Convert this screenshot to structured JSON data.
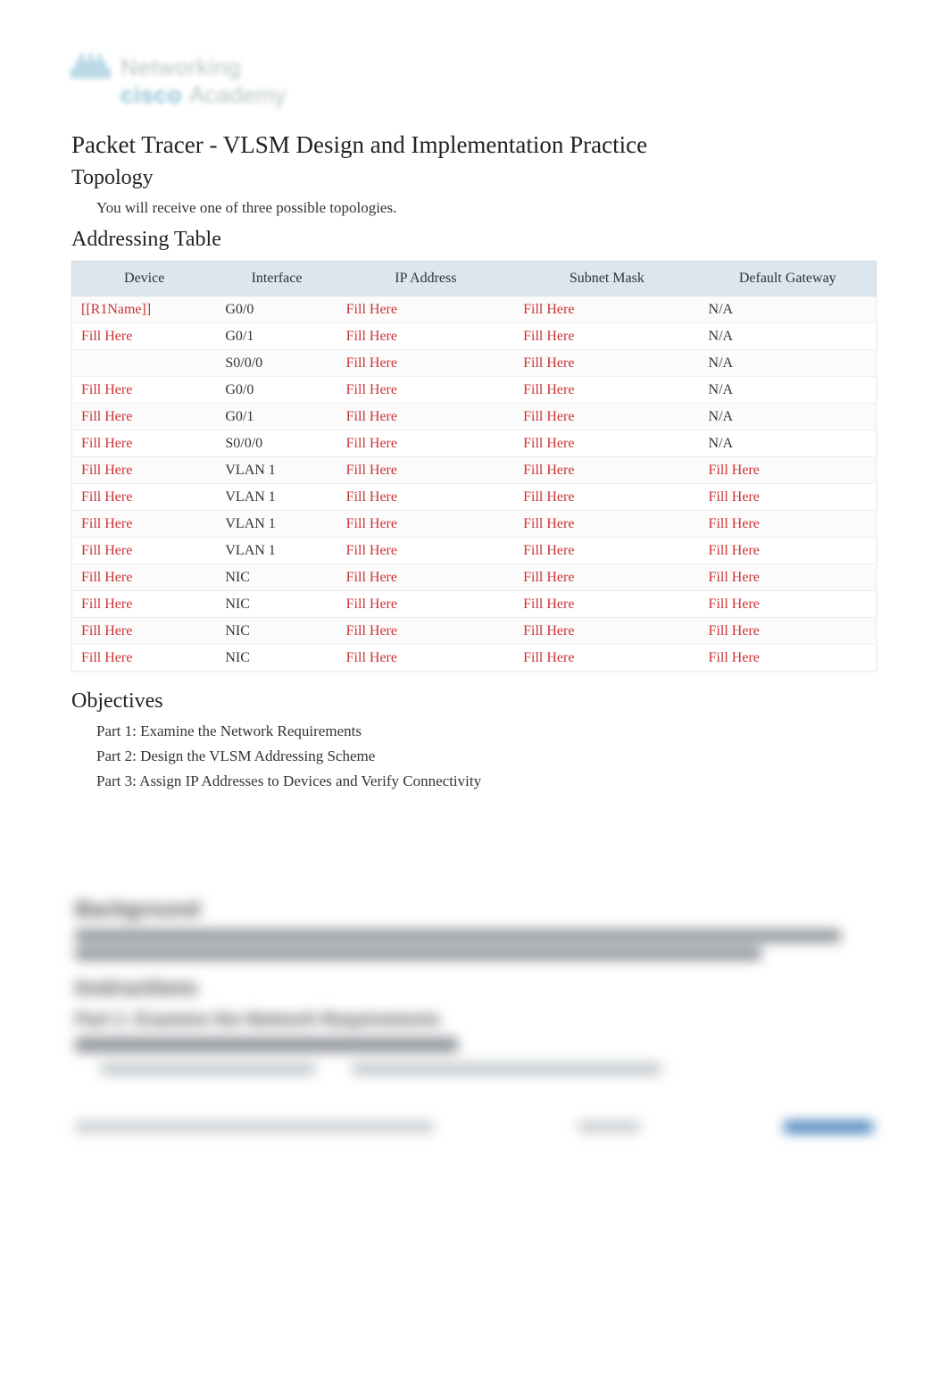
{
  "logo": {
    "top": "Networking",
    "brand": "cisco",
    "sub": "Academy"
  },
  "doc_title": "Packet Tracer - VLSM Design and Implementation Practice",
  "sections": {
    "topology": "Topology",
    "topology_text": "You will receive one of three possible topologies.",
    "addressing_table": "Addressing Table",
    "objectives": "Objectives"
  },
  "table": {
    "headers": {
      "device": "Device",
      "interface": "Interface",
      "ip": "IP Address",
      "mask": "Subnet Mask",
      "gateway": "Default Gateway"
    },
    "rows": [
      {
        "device": "[[R1Name]]",
        "device_fill": true,
        "interface": "G0/0",
        "ip": "Fill Here",
        "mask": "Fill Here",
        "gw": "N/A",
        "gw_fill": false
      },
      {
        "device": "Fill Here",
        "device_fill": true,
        "interface": "G0/1",
        "ip": "Fill Here",
        "mask": "Fill Here",
        "gw": "N/A",
        "gw_fill": false
      },
      {
        "device": "",
        "device_fill": false,
        "interface": "S0/0/0",
        "ip": "Fill Here",
        "mask": "Fill Here",
        "gw": "N/A",
        "gw_fill": false
      },
      {
        "device": "Fill Here",
        "device_fill": true,
        "interface": "G0/0",
        "ip": "Fill Here",
        "mask": "Fill Here",
        "gw": "N/A",
        "gw_fill": false
      },
      {
        "device": "Fill Here",
        "device_fill": true,
        "interface": "G0/1",
        "ip": "Fill Here",
        "mask": "Fill Here",
        "gw": "N/A",
        "gw_fill": false
      },
      {
        "device": "Fill Here",
        "device_fill": true,
        "interface": "S0/0/0",
        "ip": "Fill Here",
        "mask": "Fill Here",
        "gw": "N/A",
        "gw_fill": false
      },
      {
        "device": "Fill Here",
        "device_fill": true,
        "interface": "VLAN 1",
        "ip": "Fill Here",
        "mask": "Fill Here",
        "gw": "Fill Here",
        "gw_fill": true
      },
      {
        "device": "Fill Here",
        "device_fill": true,
        "interface": "VLAN 1",
        "ip": "Fill Here",
        "mask": "Fill Here",
        "gw": "Fill Here",
        "gw_fill": true
      },
      {
        "device": "Fill Here",
        "device_fill": true,
        "interface": "VLAN 1",
        "ip": "Fill Here",
        "mask": "Fill Here",
        "gw": "Fill Here",
        "gw_fill": true
      },
      {
        "device": "Fill Here",
        "device_fill": true,
        "interface": "VLAN 1",
        "ip": "Fill Here",
        "mask": "Fill Here",
        "gw": "Fill Here",
        "gw_fill": true
      },
      {
        "device": "Fill Here",
        "device_fill": true,
        "interface": "NIC",
        "ip": "Fill Here",
        "mask": "Fill Here",
        "gw": "Fill Here",
        "gw_fill": true
      },
      {
        "device": "Fill Here",
        "device_fill": true,
        "interface": "NIC",
        "ip": "Fill Here",
        "mask": "Fill Here",
        "gw": "Fill Here",
        "gw_fill": true
      },
      {
        "device": "Fill Here",
        "device_fill": true,
        "interface": "NIC",
        "ip": "Fill Here",
        "mask": "Fill Here",
        "gw": "Fill Here",
        "gw_fill": true
      },
      {
        "device": "Fill Here",
        "device_fill": true,
        "interface": "NIC",
        "ip": "Fill Here",
        "mask": "Fill Here",
        "gw": "Fill Here",
        "gw_fill": true
      }
    ]
  },
  "objectives": [
    "Part 1: Examine the Network Requirements",
    "Part 2: Design the VLSM Addressing Scheme",
    "Part 3: Assign IP Addresses to Devices and Verify Connectivity"
  ]
}
